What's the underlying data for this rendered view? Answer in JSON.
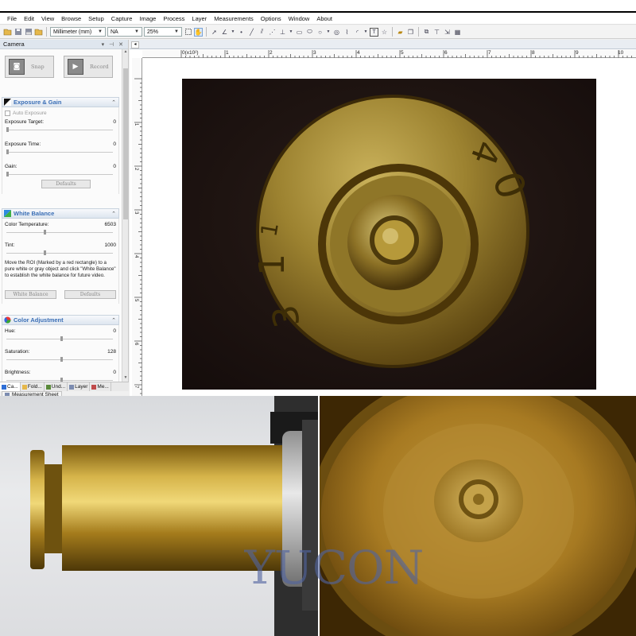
{
  "menu": [
    "File",
    "Edit",
    "View",
    "Browse",
    "Setup",
    "Capture",
    "Image",
    "Process",
    "Layer",
    "Measurements",
    "Options",
    "Window",
    "About"
  ],
  "toolbar": {
    "unit_value": "Millimeter (mm)",
    "na_value": "NA",
    "zoom_value": "25%"
  },
  "panel": {
    "title": "Camera",
    "snap_label": "Snap",
    "record_label": "Record",
    "exposure": {
      "title": "Exposure & Gain",
      "auto_label": "Auto Exposure",
      "target_label": "Exposure Target:",
      "target_value": "0",
      "time_label": "Exposure Time:",
      "time_value": "0",
      "gain_label": "Gain:",
      "gain_value": "0",
      "defaults_label": "Defaults"
    },
    "white_balance": {
      "title": "White Balance",
      "temp_label": "Color Temperature:",
      "temp_value": "6503",
      "tint_label": "Tint:",
      "tint_value": "1000",
      "note": "Move the ROI (Marked by a red rectangle) to a pure white or gray object and click \"White Balance\" to establish the white balance for future video.",
      "wb_button": "White Balance",
      "defaults_label": "Defaults"
    },
    "color_adj": {
      "title": "Color Adjustment",
      "hue_label": "Hue:",
      "hue_value": "0",
      "sat_label": "Saturation:",
      "sat_value": "128",
      "bright_label": "Brightness:",
      "bright_value": "0"
    },
    "tabs": [
      "Ca...",
      "Fold...",
      "Und...",
      "Layer",
      "Me..."
    ],
    "measurement_tab": "Measurement Sheet"
  },
  "ruler": {
    "h_labels": [
      "0(x10²)",
      "1",
      "2",
      "3",
      "4",
      "5",
      "6",
      "7",
      "8",
      "9",
      "10"
    ],
    "v_labels": [
      "1",
      "2",
      "3",
      "4",
      "5",
      "6",
      "7"
    ]
  },
  "watermark": "YUCON"
}
